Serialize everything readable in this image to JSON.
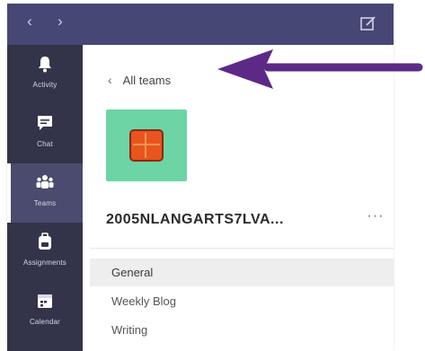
{
  "sidebar": {
    "items": [
      {
        "label": "Activity",
        "icon": "bell-icon"
      },
      {
        "label": "Chat",
        "icon": "chat-icon"
      },
      {
        "label": "Teams",
        "icon": "teams-icon",
        "active": true
      },
      {
        "label": "Assignments",
        "icon": "backpack-icon"
      },
      {
        "label": "Calendar",
        "icon": "calendar-icon"
      }
    ]
  },
  "panel": {
    "back_label": "All teams",
    "team_name": "2005NLANGARTS7LVA...",
    "more_label": "···",
    "channels": [
      {
        "label": "General",
        "selected": true
      },
      {
        "label": "Weekly Blog"
      },
      {
        "label": "Writing"
      }
    ]
  },
  "colors": {
    "titlebar": "#464775",
    "rail": "#33344a",
    "avatar_bg": "#6dd4a6",
    "logo": "#e8551e",
    "arrow": "#5c2a86"
  }
}
